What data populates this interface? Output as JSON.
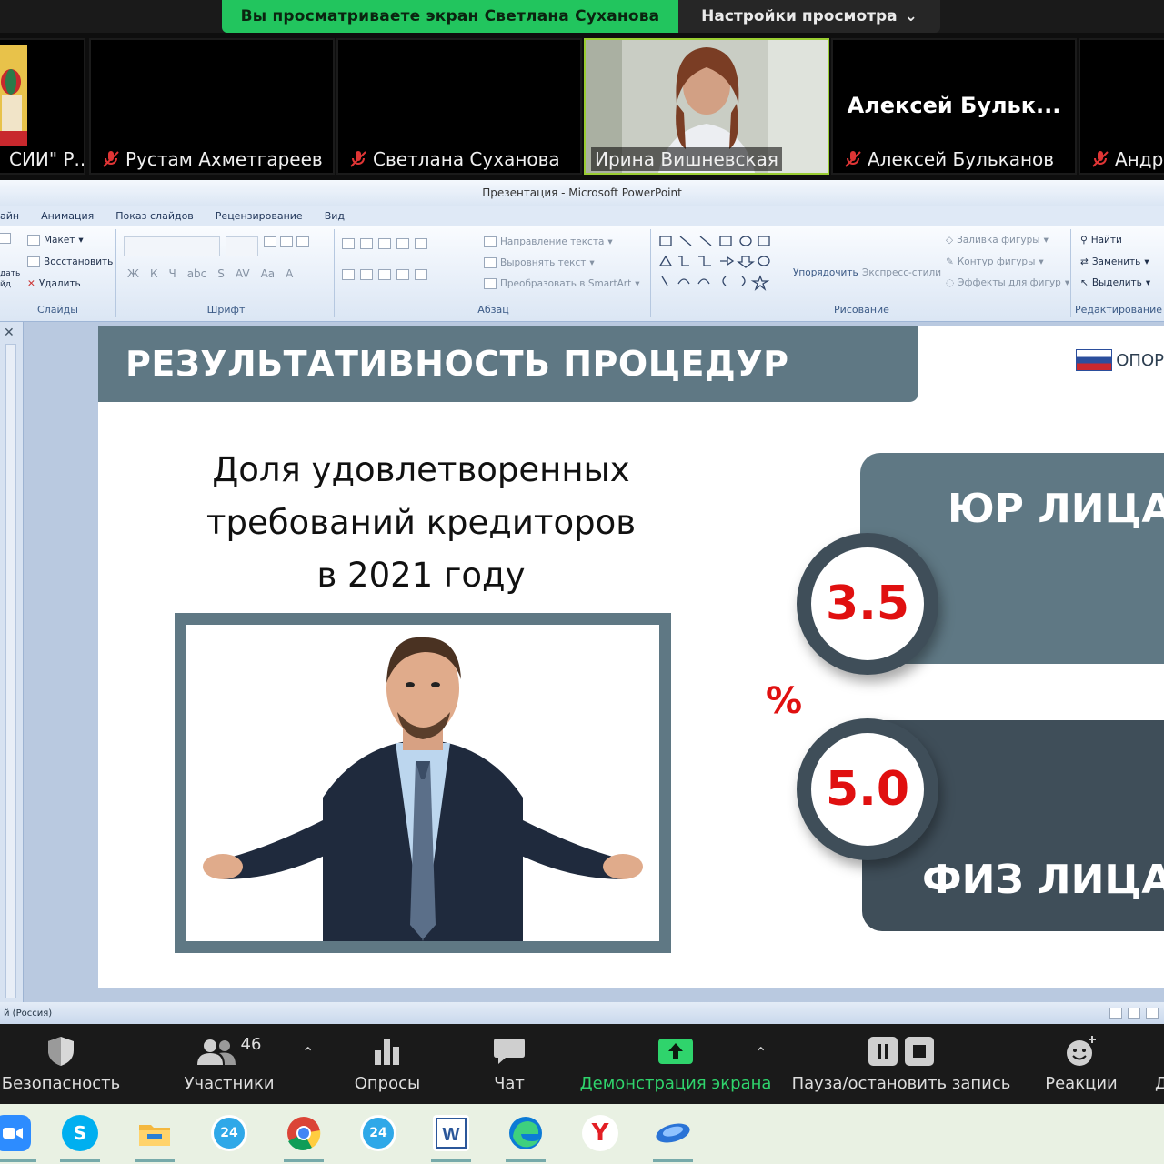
{
  "share_banner": {
    "viewing_text": "Вы просматриваете экран Светлана Суханова",
    "options_label": "Настройки просмотра"
  },
  "participants": [
    {
      "name": "СИИ\" Р...",
      "muted": false
    },
    {
      "name": "Рустам Ахметгареев",
      "muted": true
    },
    {
      "name": "Светлана Суханова",
      "muted": true
    },
    {
      "name": "Ирина Вишневская",
      "muted": false
    },
    {
      "name": "Алексей Бульканов",
      "muted": true,
      "big_name": "Алексей  Бульк..."
    },
    {
      "name": "Андре",
      "muted": true
    }
  ],
  "ppt": {
    "window_title": "Презентация - Microsoft PowerPoint",
    "tabs": [
      "айн",
      "Анимация",
      "Показ слайдов",
      "Рецензирование",
      "Вид"
    ],
    "groups": {
      "slides": {
        "label": "Слайды",
        "items": [
          "Макет",
          "Восстановить",
          "Удалить",
          "дать",
          "йд"
        ]
      },
      "font": {
        "label": "Шрифт"
      },
      "paragraph": {
        "label": "Абзац",
        "items": [
          "Направление текста",
          "Выровнять текст",
          "Преобразовать в SmartArt"
        ]
      },
      "drawing": {
        "label": "Рисование",
        "items": [
          "Упорядочить",
          "Экспресс-стили",
          "Заливка фигуры",
          "Контур фигуры",
          "Эффекты для фигур"
        ]
      },
      "editing": {
        "label": "Редактирование",
        "items": [
          "Найти",
          "Заменить",
          "Выделить"
        ]
      }
    },
    "status_text": "й (Россия)"
  },
  "slide": {
    "header": "РЕЗУЛЬТАТИВНОСТЬ ПРОЦЕДУР",
    "logo_text": "ОПОР",
    "stat_title_lines": [
      "Доля удовлетворенных",
      "требований кредиторов",
      "в 2021 году"
    ],
    "jur_label": "ЮР ЛИЦА",
    "fiz_label": "ФИЗ ЛИЦА",
    "jur_value": "3.5",
    "fiz_value": "5.0",
    "percent_sign": "%",
    "accent_red": "#e01010",
    "slate_color": "#5f7884"
  },
  "toolbar": {
    "security": "Безопасность",
    "participants": "Участники",
    "participants_count": "46",
    "polls": "Опросы",
    "chat": "Чат",
    "share_screen": "Демонстрация экрана",
    "record": "Пауза/остановить запись",
    "reactions": "Реакции",
    "more_partial": "Д"
  },
  "taskbar": {
    "icons": [
      "zoom-icon",
      "skype-icon",
      "file-explorer-icon",
      "bitrix24-icon",
      "chrome-icon",
      "bitrix24-icon",
      "word-icon",
      "edge-icon",
      "yandex-icon",
      "zoom-meetings-icon"
    ]
  }
}
